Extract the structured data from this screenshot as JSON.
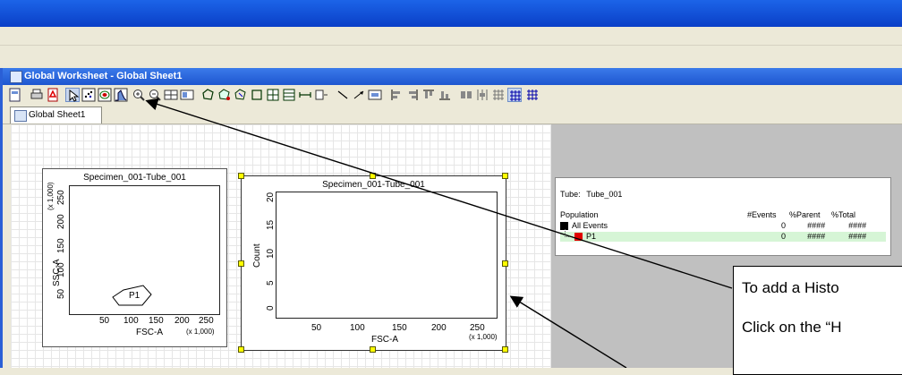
{
  "window": {
    "title": "Global Worksheet - Global Sheet1"
  },
  "tabs": [
    {
      "label": "Global Sheet1"
    }
  ],
  "toolbar": {
    "icons": [
      "worksheet-icon",
      "print-icon",
      "pdf-icon",
      "pointer-icon",
      "dot-plot-icon",
      "contour-plot-icon",
      "histogram-icon",
      "zoom-in-icon",
      "zoom-out-icon",
      "grid-icon",
      "layout-icon",
      "polygon-gate-icon",
      "snap-to-gate-icon",
      "autogate-icon",
      "rectangle-gate-icon",
      "quadrant-gate-icon",
      "interval-gate-icon",
      "split-gate-icon",
      "line-icon",
      "arrow-icon",
      "text-icon",
      "align-left-icon",
      "align-right-icon",
      "align-top-icon",
      "align-bottom-icon",
      "distribute-icon",
      "arrange-icon",
      "snap-grid-icon",
      "show-grid-icon",
      "grid-lines-icon"
    ],
    "accent": "#2a5fd6"
  },
  "dot_plot": {
    "title": "Specimen_001-Tube_001",
    "ylabel": "SSC-A",
    "yscale": "(x 1,000)",
    "xlabel": "FSC-A",
    "xscale": "(x 1,000)",
    "yticks": [
      "250",
      "200",
      "150",
      "100",
      "50"
    ],
    "xticks": [
      "50",
      "100",
      "150",
      "200",
      "250"
    ],
    "gate_label": "P1"
  },
  "histogram": {
    "title": "Specimen_001-Tube_001",
    "ylabel": "Count",
    "xlabel": "FSC-A",
    "xscale": "(x 1,000)",
    "yticks": [
      "20",
      "15",
      "10",
      "5",
      "0"
    ],
    "xticks": [
      "50",
      "100",
      "150",
      "200",
      "250"
    ]
  },
  "pop_table": {
    "tube_label": "Tube:",
    "tube_value": "Tube_001",
    "headers": [
      "Population",
      "#Events",
      "%Parent",
      "%Total"
    ],
    "rows": [
      {
        "name": "All Events",
        "events": "0",
        "parent": "####",
        "total": "####",
        "color": "#000000"
      },
      {
        "name": "P1",
        "events": "0",
        "parent": "####",
        "total": "####",
        "color": "#e00000"
      }
    ]
  },
  "callout": {
    "line1": "To add a Histo",
    "line2": "Click on the “H"
  }
}
